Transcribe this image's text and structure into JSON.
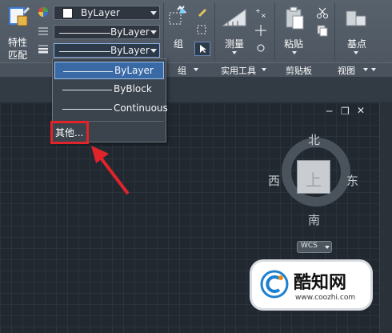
{
  "ribbon": {
    "match_properties_label_1": "特性",
    "match_properties_label_2": "匹配",
    "color_combo_value": "ByLayer",
    "linetype_combo_value": "ByLayer",
    "lineweight_combo_value": "ByLayer",
    "group_label": "组",
    "measure_label": "测量",
    "paste_label": "粘贴",
    "base_label": "基点",
    "panel_titles": [
      "组",
      "实用工具",
      "剪贴板",
      "视图"
    ]
  },
  "dropdown": {
    "items": [
      "ByLayer",
      "ByBlock",
      "Continuous"
    ],
    "other_label": "其他..."
  },
  "viewcube": {
    "north": "北",
    "south": "南",
    "west": "西",
    "east": "东",
    "top": "上",
    "wcs": "WCS"
  },
  "watermark": {
    "brand": "酷知网",
    "url": "www.coozhi.com"
  },
  "colors": {
    "ribbon": "#525c66",
    "canvas": "#212830",
    "highlight": "#3a6aa6",
    "annotation": "#e0242a"
  }
}
